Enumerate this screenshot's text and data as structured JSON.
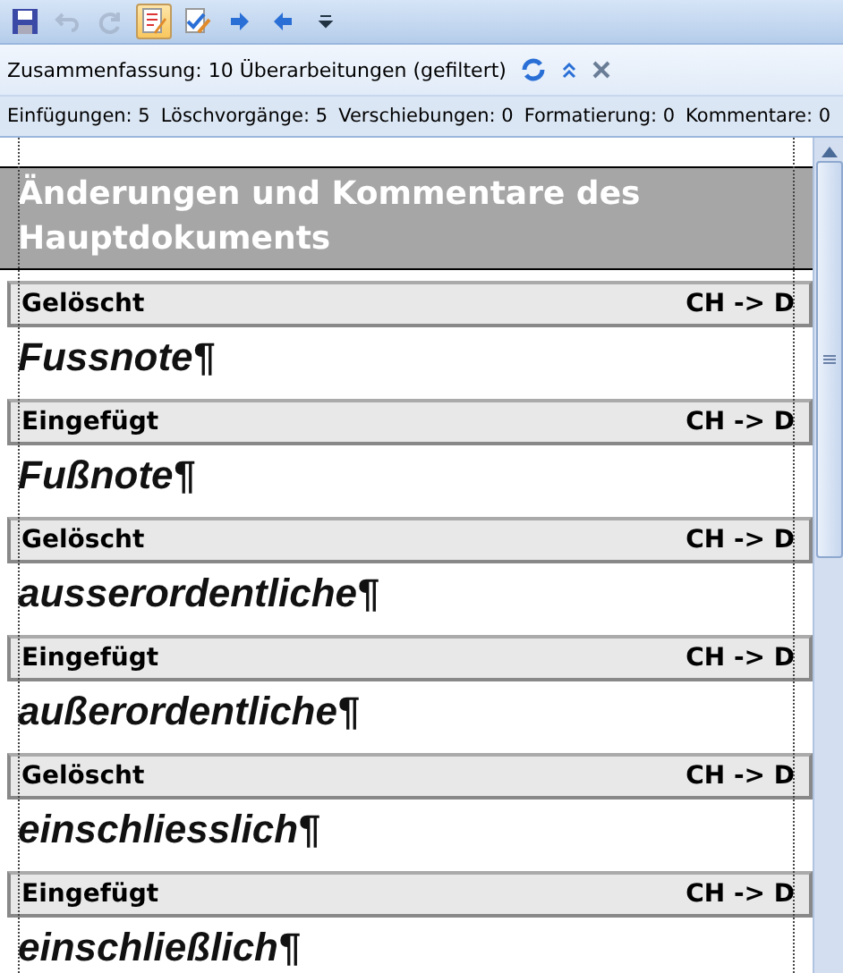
{
  "toolbar": [
    {
      "kind": "save",
      "selected": false,
      "disabled": false
    },
    {
      "kind": "undo",
      "selected": false,
      "disabled": true
    },
    {
      "kind": "redo",
      "selected": false,
      "disabled": true
    },
    {
      "kind": "track",
      "selected": true,
      "disabled": false
    },
    {
      "kind": "review",
      "selected": false,
      "disabled": false
    },
    {
      "kind": "next",
      "selected": false,
      "disabled": false
    },
    {
      "kind": "previous",
      "selected": false,
      "disabled": false
    },
    {
      "kind": "customize",
      "selected": false,
      "disabled": false
    }
  ],
  "summary": {
    "text": "Zusammenfassung: 10 Überarbeitungen (gefiltert)"
  },
  "counts": [
    "Einfügungen: 5",
    "Löschvorgänge: 5",
    "Verschiebungen: 0",
    "Formatierung: 0",
    "Kommentare: 0"
  ],
  "document": {
    "heading": "Änderungen und Kommentare des Hauptdokuments",
    "revisions": [
      {
        "type": "Gelöscht",
        "author": "CH -> D",
        "text": "Fussnote¶"
      },
      {
        "type": "Eingefügt",
        "author": "CH -> D",
        "text": "Fußnote¶"
      },
      {
        "type": "Gelöscht",
        "author": "CH -> D",
        "text": "ausserordentliche¶"
      },
      {
        "type": "Eingefügt",
        "author": "CH -> D",
        "text": "außerordentliche¶"
      },
      {
        "type": "Gelöscht",
        "author": "CH -> D",
        "text": "einschliesslich¶"
      },
      {
        "type": "Eingefügt",
        "author": "CH -> D",
        "text": "einschließlich¶"
      }
    ]
  }
}
